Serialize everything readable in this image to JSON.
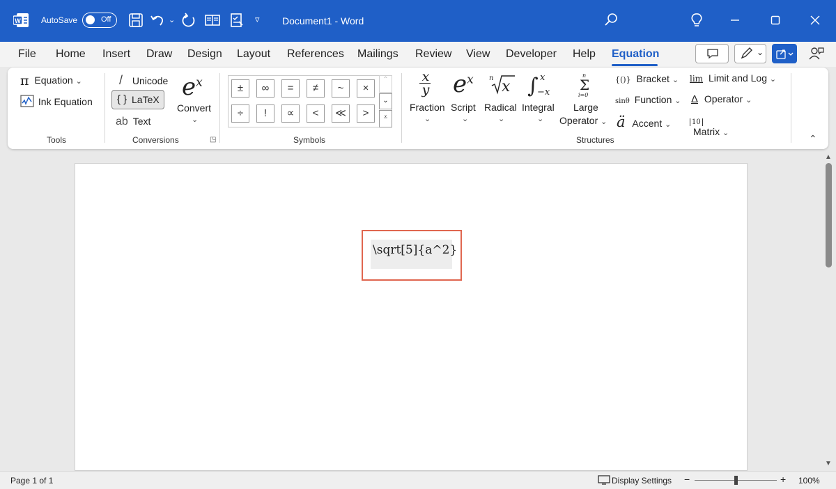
{
  "titlebar": {
    "autosave_label": "AutoSave",
    "autosave_state": "Off",
    "document_title": "Document1  -  Word"
  },
  "menu": {
    "items": [
      "File",
      "Home",
      "Insert",
      "Draw",
      "Design",
      "Layout",
      "References",
      "Mailings",
      "Review",
      "View",
      "Developer",
      "Help",
      "Equation"
    ],
    "active": "Equation"
  },
  "ribbon": {
    "tools": {
      "equation_label": "Equation",
      "ink_equation_label": "Ink Equation",
      "group_label": "Tools"
    },
    "conversions": {
      "unicode_label": "Unicode",
      "latex_label": "LaTeX",
      "text_label": "Text",
      "convert_label": "Convert",
      "group_label": "Conversions"
    },
    "symbols": {
      "row1": [
        "±",
        "∞",
        "=",
        "≠",
        "~",
        "×"
      ],
      "row2": [
        "÷",
        "!",
        "∝",
        "<",
        "≪",
        ">"
      ],
      "group_label": "Symbols"
    },
    "structures": {
      "fraction_label": "Fraction",
      "script_label": "Script",
      "radical_label": "Radical",
      "integral_label": "Integral",
      "large_label": "Large",
      "operator_label": "Operator",
      "bracket_label": "Bracket",
      "function_label": "Function",
      "accent_label": "Accent",
      "limit_label": "Limit and Log",
      "operator2_label": "Operator",
      "matrix_label": "Matrix",
      "group_label": "Structures"
    }
  },
  "document": {
    "equation_text": "\\sqrt[5]{a^2}"
  },
  "statusbar": {
    "page_info": "Page 1 of 1",
    "display_settings": "Display Settings",
    "zoom": "100%",
    "zoom_fraction": 0.5
  },
  "colors": {
    "titlebar": "#1f5fc7",
    "highlight_border": "#e0664f"
  }
}
